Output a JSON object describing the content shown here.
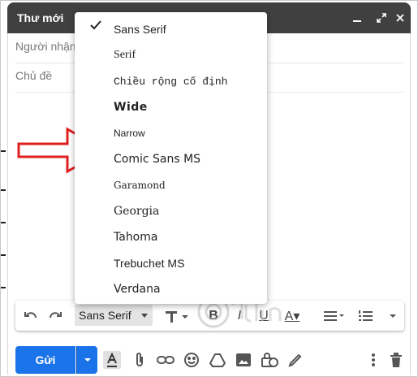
{
  "window": {
    "title": "Thư mới",
    "minimize_icon": "minimize-icon",
    "expand_icon": "expand-icon",
    "close_icon": "close-icon"
  },
  "fields": {
    "to_placeholder": "Người nhận",
    "subject_placeholder": "Chủ đề"
  },
  "font_menu": {
    "selected": "Sans Serif",
    "items": [
      {
        "label": "Sans Serif",
        "checked": true
      },
      {
        "label": "Serif"
      },
      {
        "label": "Chiều rộng cố định"
      },
      {
        "label": "Wide"
      },
      {
        "label": "Narrow"
      },
      {
        "label": "Comic Sans MS"
      },
      {
        "label": "Garamond"
      },
      {
        "label": "Georgia"
      },
      {
        "label": "Tahoma"
      },
      {
        "label": "Trebuchet MS"
      },
      {
        "label": "Verdana"
      }
    ]
  },
  "toolbar": {
    "font_label": "Sans Serif",
    "icons": [
      "undo-icon",
      "redo-icon",
      "font-size-icon",
      "bold-icon",
      "italic-icon",
      "underline-icon",
      "text-color-icon",
      "align-icon",
      "numbered-list-icon",
      "more-formatting-icon"
    ]
  },
  "bottom_bar": {
    "send_label": "Gửi",
    "icons": [
      "formatting-icon",
      "attach-icon",
      "link-icon",
      "emoji-icon",
      "drive-icon",
      "photo-icon",
      "confidential-icon",
      "signature-icon",
      "more-options-icon",
      "delete-icon"
    ]
  },
  "colors": {
    "title_bar": "#404040",
    "send_button": "#1a73e8",
    "annotation_arrow": "#e02020"
  }
}
